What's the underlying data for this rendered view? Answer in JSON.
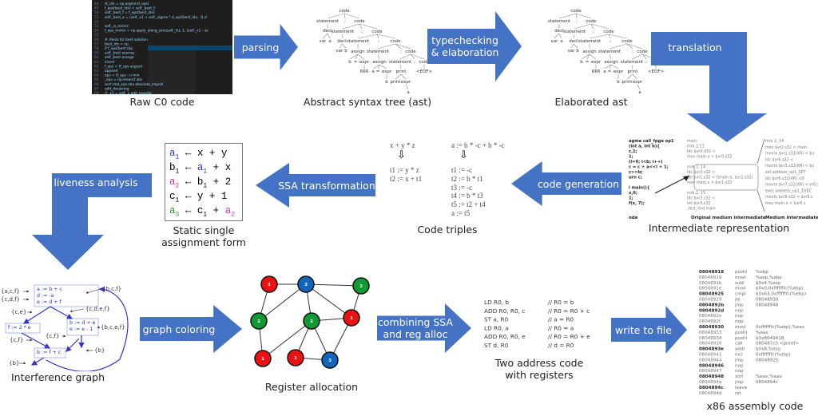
{
  "colors": {
    "arrow": "#4472C4",
    "red": "#ee1111",
    "green": "#119933",
    "blue": "#1166bb",
    "ssa_a1": "#2233cc",
    "ssa_a2": "#dd3399",
    "ssa_a3": "#229922"
  },
  "stages": {
    "raw": {
      "caption": "Raw C0 code",
      "lines": [
        [
          "48",
          "st_idx = np.argmin(f_eps)"
        ],
        [
          "49",
          "  f_eps[best_idx] < self._best_f:"
        ],
        [
          "50",
          "    self._best_f = f_eps[best_idx]"
        ],
        [
          "51",
          "    self._best_x = (self._x1 + self._sigma * d_eps[best_idx, :]).cl"
        ],
        [
          "52",
          ""
        ],
        [
          "53",
          "  self._is_mirror:"
        ],
        [
          "54",
          "    f_eps_mirror = np.apply_along_axis(self._fct, 1, (self._x1 - se"
        ],
        [
          "55",
          ""
        ],
        [
          "56",
          "    # check for best solution"
        ],
        [
          "57",
          "    best_idx = np."
        ],
        [
          "58",
          "    if f_eps[best  clip"
        ],
        [
          "59",
          "        self._best  asarray"
        ],
        [
          "60",
          "        self._best  arange"
        ],
        [
          "61",
          "                    insert"
        ],
        [
          "62",
          "    f_eps = (f_eps  argsort"
        ],
        [
          "63",
          "                    append"
        ],
        [
          "64",
          "  eps = (f_eps - n  min"
        ],
        [
          "65",
          "  _eps = np.mean(f  abs"
        ],
        [
          "66",
          "  sert (md_eps.sha  absolute_import"
        ],
        [
          "67",
          "                    add_docstring"
        ],
        [
          "68",
          "  (f._x1 = self._x  add_newdoc"
        ]
      ]
    },
    "ast": {
      "caption": "Abstract syntax tree (ast)"
    },
    "elab": {
      "caption": "Elaborated ast"
    },
    "ir": {
      "caption": "Intermediate representation",
      "col1": [
        "agma call_fpga op1",
        "(int a, int b){",
        "  c,1;",
        "1;",
        "(i=0; i<b; i++)",
        "  c = c + a<<i + 1;",
        "  c>>b;",
        "urn c;",
        "",
        "l main(){",
        "  x,6;",
        "1;",
        "f(x, 7);"
      ],
      "col1_label": "ode",
      "col2": [
        "main:",
        "    mrk  2,13",
        "    ldc    $vr0.d32 <",
        "    mov  main.x < $vr0.s32",
        "",
        "    mrk  2, 14",
        "    ldc    $vr2.s32 <",
        "    cal $vr1.s32 < f(main.x, $vr2.s32)",
        "    mov main.x < $vr1.s32",
        "",
        "    mrk  2, 15",
        "    ldc    $vr3.s32 <",
        "    ret    $vr3.s32",
        ".test_end main"
      ],
      "col2_label": "Original medium intermediate",
      "col3": [
        "mrk       2, 14",
        "mov     $vr2.s32 < main",
        "movtx $vr1.s32(XR) < $v",
        "ldc        $vr6.s32 <",
        "movtx $vr3.s32(XR) < $v",
        "set     address_op1_SET",
        "ldc   $vr6.s32(XR) <0",
        "movtx $vr7.s32(XR) < vr6.s32",
        "exec    address_op1_EXEC",
        "movfx $vr8.s32 < $vr5.s",
        "mov       main.x < $vr8.s"
      ],
      "col3_label": "Medium intermediate repres"
    },
    "triples": {
      "caption": "Code triples",
      "left_expr": "x + y * z",
      "right_expr": "a := b * -c + b * -c",
      "down_arrow": "⇩",
      "left": [
        "t1 := y * z",
        "t2 := x + t1"
      ],
      "right": [
        "t1 := -c",
        "t2 := b * t1",
        "t3 := -c",
        "t4 := b * t3",
        "t5 := t2 + t4",
        "a := t5"
      ]
    },
    "ssa": {
      "caption_1": "Static single",
      "caption_2": "assignment form",
      "arrow_glyph": "←",
      "rows": [
        {
          "lhs": "a",
          "lsub": "1",
          "lc": "a1",
          "rhs": [
            [
              "x",
              ""
            ],
            [
              " + ",
              ""
            ],
            [
              "y",
              ""
            ]
          ]
        },
        {
          "lhs": "b",
          "lsub": "1",
          "lc": "",
          "rhs": [
            [
              "a",
              "1",
              "a1"
            ],
            [
              " + ",
              ""
            ],
            [
              "x",
              ""
            ]
          ]
        },
        {
          "lhs": "a",
          "lsub": "2",
          "lc": "a2",
          "rhs": [
            [
              "b",
              "1",
              ""
            ],
            [
              " + ",
              ""
            ],
            [
              "2",
              ""
            ]
          ]
        },
        {
          "lhs": "c",
          "lsub": "1",
          "lc": "",
          "rhs": [
            [
              "y",
              ""
            ],
            [
              " + ",
              ""
            ],
            [
              "1",
              ""
            ]
          ]
        },
        {
          "lhs": "a",
          "lsub": "3",
          "lc": "a3",
          "rhs": [
            [
              "c",
              "1",
              ""
            ],
            [
              " + ",
              ""
            ],
            [
              "a",
              "2",
              "a2"
            ]
          ]
        }
      ]
    },
    "interference": {
      "caption": "Interference graph",
      "box1": [
        "a := b + c",
        "d := -a",
        "e := d + f"
      ],
      "box2": [
        "f := 2 * e"
      ],
      "box3": [
        "b := d + e",
        "e := e - 1"
      ],
      "box4": [
        "b := f + c"
      ],
      "sets": [
        "{a,c,f}",
        "{c,d,f}",
        "{b,c,f}",
        "{c,e}",
        "{c,d,e,f}",
        "{b,c,e,f}",
        "{c,f}",
        "{c,f}",
        "{b}",
        "{b}"
      ]
    },
    "regalloc": {
      "caption": "Register allocation",
      "nodes": [
        {
          "c": "red",
          "n": "1"
        },
        {
          "c": "blue",
          "n": "3"
        },
        {
          "c": "green",
          "n": "2"
        },
        {
          "c": "green",
          "n": "2"
        },
        {
          "c": "green",
          "n": "2"
        },
        {
          "c": "red",
          "n": "1"
        },
        {
          "c": "red",
          "n": "1"
        },
        {
          "c": "red",
          "n": "1"
        },
        {
          "c": "blue",
          "n": "3"
        }
      ]
    },
    "twoaddr": {
      "caption_1": "Two address code",
      "caption_2": "with registers",
      "lines": [
        [
          "LD  R0, b",
          "// R0 = b"
        ],
        [
          "ADD R0, R0, c",
          "// R0 = R0 + c"
        ],
        [
          "ST  a, R0",
          "// a = R0"
        ],
        [
          "LD  R0, a",
          "// R0 = a"
        ],
        [
          "ADD R0, R0, e",
          "// R0 = R0 + e"
        ],
        [
          "ST  d, R0",
          "// d = R0"
        ]
      ]
    },
    "x86": {
      "caption": "x86 assembly code",
      "lines": [
        [
          "08048918",
          "pushl",
          "%ebp",
          1
        ],
        [
          "08048919",
          "movl",
          "%esp,%ebp",
          0
        ],
        [
          "0804891b",
          "subl",
          "$0x4,%esp",
          0
        ],
        [
          "0804891e",
          "movl",
          "$0x0,0xfffffffc(%ebp)",
          0
        ],
        [
          "08048925",
          "cmpl",
          "$0x63,0xfffffffc(%ebp)",
          1
        ],
        [
          "08048929",
          "jle",
          "08048930",
          0
        ],
        [
          "0804892b",
          "jmp",
          "08048948",
          1
        ],
        [
          "0804892d",
          "nop",
          "",
          1
        ],
        [
          "0804892e",
          "nop",
          "",
          0
        ],
        [
          "0804892f",
          "nop",
          "",
          0
        ],
        [
          "08048930",
          "movl",
          "0xfffffffc(%ebp),%eax",
          1
        ],
        [
          "08048933",
          "pushl",
          "%eax",
          0
        ],
        [
          "08048934",
          "pushl",
          "$0x8049418",
          0
        ],
        [
          "08048939",
          "call",
          "080487c0 <printf>",
          0
        ],
        [
          "0804893e",
          "addl",
          "$0x8,%esp",
          1
        ],
        [
          "08048941",
          "incl",
          "0xfffffffc(%ebp)",
          0
        ],
        [
          "08048944",
          "jmp",
          "08048925",
          0
        ],
        [
          "08048946",
          "nop",
          "",
          1
        ],
        [
          "08048947",
          "nop",
          "",
          0
        ],
        [
          "08048948",
          "xorl",
          "%eax,%eax",
          1
        ],
        [
          "0804894a",
          "jmp",
          "0804894c",
          0
        ],
        [
          "0804894c",
          "leave",
          "",
          1
        ],
        [
          "0804894d",
          "ret",
          "",
          0
        ]
      ]
    }
  },
  "arrows": {
    "parsing": "parsing",
    "typecheck_1": "typechecking",
    "typecheck_2": "& elaboration",
    "translation": "translation",
    "codegen": "code generation",
    "ssa": "SSA transformation",
    "liveness": "liveness analysis",
    "coloring": "graph coloring",
    "combine_1": "combining SSA",
    "combine_2": "and reg alloc",
    "write": "write to file"
  },
  "ast_tree": [
    "code",
    "statement",
    ";",
    "code",
    "decl",
    "var",
    "a",
    "statement",
    ";",
    "code",
    "decl",
    "var",
    "b",
    "statement",
    ";",
    "code",
    "assign",
    "b",
    "=",
    "expr",
    "666",
    "statement",
    ";",
    "code",
    "assign",
    "a",
    "=",
    "expr",
    "b",
    "statement",
    ";",
    "code",
    "print",
    "<EOF>",
    "print",
    "expr",
    "a"
  ]
}
